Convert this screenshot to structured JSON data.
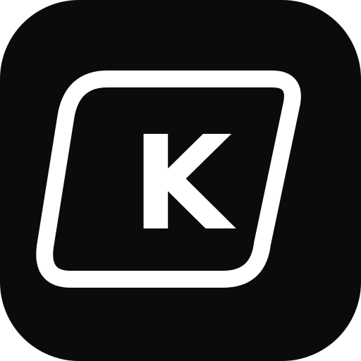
{
  "app_icon": {
    "name": "keycap-k-icon",
    "letter": "K",
    "colors": {
      "background": "#0b0b0b",
      "foreground": "#ffffff"
    }
  }
}
